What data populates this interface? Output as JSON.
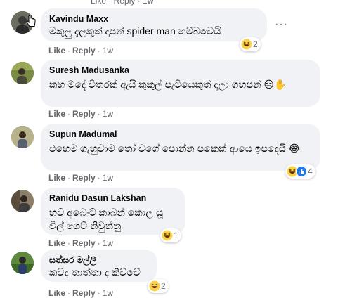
{
  "top_fragment": "Like · Reply · 1w",
  "comments": [
    {
      "author": "Kavindu Maxx",
      "text": "මකුලු දැලකුත් දාපන් spider man හම්බවෙයි",
      "like": "Like",
      "reply": "Reply",
      "time": "1w",
      "reaction_count": "2",
      "reactions": [
        "haha-icon"
      ],
      "avatar_color": "#5a5f4e"
    },
    {
      "author": "Suresh Madusanka",
      "text": "කහ මදේ විතරක් ඇයි කුකුල් පැටියෙකුත් දාලා ගහපන් 😑✋",
      "like": "Like",
      "reply": "Reply",
      "time": "1w",
      "avatar_color": "#6f7d3e"
    },
    {
      "author": "Supun Madumal",
      "text": "එහෙම ගැහුවාම තෝ වගේ පොන්න පකෙක් ආයෙ ඉපදෙයි 😂",
      "like": "Like",
      "reply": "Reply",
      "time": "1w",
      "reaction_count": "4",
      "reactions": [
        "haha-icon",
        "like-icon"
      ],
      "avatar_color": "#8a8c63"
    },
    {
      "author": "Ranidu Dasun Lakshan",
      "text": "හව් අබෙංට් කාබන් කොල යූ විල් ගෙට් නිවුන්නු",
      "like": "Like",
      "reply": "Reply",
      "time": "1w",
      "reaction_count": "1",
      "reactions": [
        "haha-icon"
      ],
      "avatar_color": "#7a6a5a"
    },
    {
      "author": "සත්සර මල්ලී",
      "text": "කව්ද තාත්තා ද කිව්වේ",
      "like": "Like",
      "reply": "Reply",
      "time": "1w",
      "reaction_count": "2",
      "reactions": [
        "haha-icon"
      ],
      "avatar_color": "#6a8a4a"
    }
  ]
}
